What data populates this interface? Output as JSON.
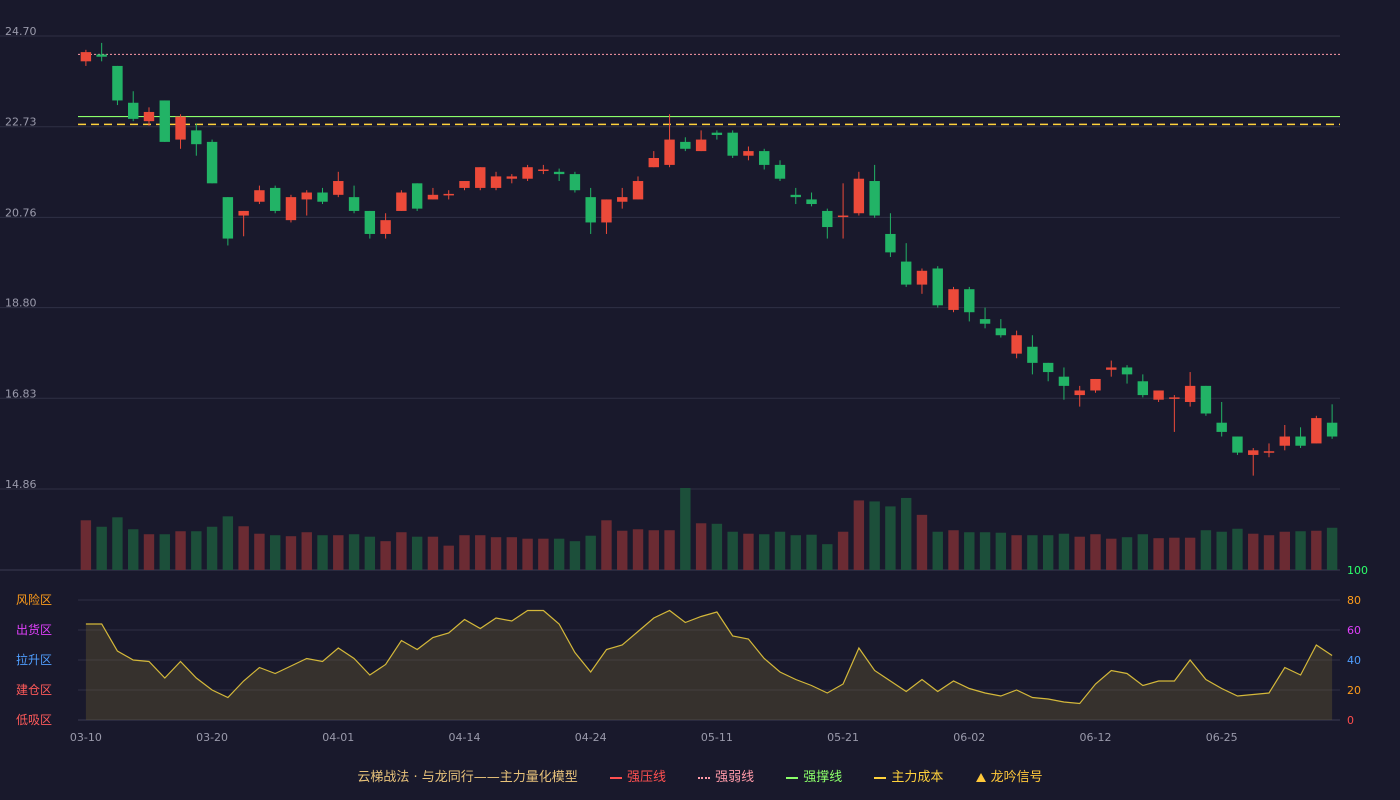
{
  "chart_data": {
    "type": "candlestick",
    "price_axis": {
      "ticks": [
        "24.70",
        "22.73",
        "20.76",
        "18.80",
        "16.83",
        "14.86"
      ],
      "min": 14.86,
      "max": 24.7
    },
    "date_axis": [
      "03-10",
      "03-20",
      "04-01",
      "04-14",
      "04-24",
      "05-11",
      "05-21",
      "06-02",
      "06-12",
      "06-25"
    ],
    "date_tick_index": [
      0,
      8,
      16,
      24,
      32,
      40,
      48,
      56,
      64,
      72
    ],
    "candles": [
      [
        24.15,
        24.35,
        24.4,
        24.05
      ],
      [
        24.3,
        24.25,
        24.55,
        24.15
      ],
      [
        24.05,
        23.3,
        24.05,
        23.2
      ],
      [
        23.25,
        22.9,
        23.5,
        22.85
      ],
      [
        22.85,
        23.05,
        23.15,
        22.75
      ],
      [
        23.3,
        22.4,
        23.3,
        22.4
      ],
      [
        22.45,
        22.95,
        23.0,
        22.25
      ],
      [
        22.65,
        22.35,
        22.8,
        22.1
      ],
      [
        22.4,
        21.5,
        22.45,
        21.5
      ],
      [
        21.2,
        20.3,
        21.2,
        20.15
      ],
      [
        20.8,
        20.9,
        20.9,
        20.35
      ],
      [
        21.1,
        21.35,
        21.45,
        21.05
      ],
      [
        21.4,
        20.9,
        21.45,
        20.85
      ],
      [
        20.7,
        21.2,
        21.25,
        20.65
      ],
      [
        21.15,
        21.3,
        21.35,
        20.8
      ],
      [
        21.3,
        21.1,
        21.4,
        21.05
      ],
      [
        21.25,
        21.55,
        21.75,
        21.2
      ],
      [
        21.2,
        20.9,
        21.45,
        20.85
      ],
      [
        20.9,
        20.4,
        20.9,
        20.3
      ],
      [
        20.4,
        20.7,
        20.85,
        20.3
      ],
      [
        20.9,
        21.3,
        21.35,
        20.9
      ],
      [
        21.5,
        20.95,
        21.5,
        20.9
      ],
      [
        21.15,
        21.25,
        21.4,
        21.15
      ],
      [
        21.25,
        21.27,
        21.35,
        21.15
      ],
      [
        21.4,
        21.55,
        21.55,
        21.35
      ],
      [
        21.4,
        21.85,
        21.85,
        21.35
      ],
      [
        21.4,
        21.65,
        21.75,
        21.35
      ],
      [
        21.6,
        21.65,
        21.7,
        21.5
      ],
      [
        21.6,
        21.85,
        21.9,
        21.55
      ],
      [
        21.8,
        21.8,
        21.9,
        21.7
      ],
      [
        21.75,
        21.7,
        21.82,
        21.55
      ],
      [
        21.7,
        21.35,
        21.75,
        21.3
      ],
      [
        21.2,
        20.65,
        21.4,
        20.4
      ],
      [
        20.65,
        21.15,
        21.15,
        20.4
      ],
      [
        21.1,
        21.2,
        21.4,
        20.95
      ],
      [
        21.15,
        21.55,
        21.65,
        21.15
      ],
      [
        21.85,
        22.05,
        22.2,
        21.85
      ],
      [
        21.9,
        22.45,
        23.0,
        21.85
      ],
      [
        22.4,
        22.25,
        22.5,
        22.2
      ],
      [
        22.2,
        22.45,
        22.65,
        22.2
      ],
      [
        22.6,
        22.55,
        22.65,
        22.45
      ],
      [
        22.6,
        22.1,
        22.65,
        22.05
      ],
      [
        22.1,
        22.2,
        22.3,
        22.0
      ],
      [
        22.2,
        21.9,
        22.25,
        21.8
      ],
      [
        21.9,
        21.6,
        22.0,
        21.55
      ],
      [
        21.25,
        21.2,
        21.4,
        21.05
      ],
      [
        21.15,
        21.05,
        21.3,
        21.0
      ],
      [
        20.9,
        20.55,
        20.95,
        20.3
      ],
      [
        20.8,
        20.8,
        21.5,
        20.3
      ],
      [
        20.85,
        21.6,
        21.75,
        20.8
      ],
      [
        21.55,
        20.8,
        21.9,
        20.75
      ],
      [
        20.4,
        20.0,
        20.85,
        19.9
      ],
      [
        19.8,
        19.3,
        20.2,
        19.25
      ],
      [
        19.3,
        19.6,
        19.65,
        19.1
      ],
      [
        19.65,
        18.85,
        19.7,
        18.8
      ],
      [
        18.75,
        19.2,
        19.25,
        18.7
      ],
      [
        19.2,
        18.7,
        19.25,
        18.5
      ],
      [
        18.55,
        18.45,
        18.8,
        18.35
      ],
      [
        18.35,
        18.2,
        18.55,
        18.15
      ],
      [
        17.8,
        18.2,
        18.3,
        17.7
      ],
      [
        17.95,
        17.6,
        18.2,
        17.35
      ],
      [
        17.6,
        17.4,
        17.6,
        17.2
      ],
      [
        17.3,
        17.1,
        17.5,
        16.8
      ],
      [
        16.9,
        17.0,
        17.1,
        16.65
      ],
      [
        17.0,
        17.25,
        17.25,
        16.95
      ],
      [
        17.45,
        17.5,
        17.65,
        17.3
      ],
      [
        17.5,
        17.35,
        17.55,
        17.15
      ],
      [
        17.2,
        16.9,
        17.35,
        16.85
      ],
      [
        16.8,
        17.0,
        17.0,
        16.75
      ],
      [
        16.85,
        16.85,
        16.9,
        16.1
      ],
      [
        16.75,
        17.1,
        17.4,
        16.65
      ],
      [
        17.1,
        16.5,
        17.1,
        16.45
      ],
      [
        16.3,
        16.1,
        16.75,
        16.0
      ],
      [
        16.0,
        15.65,
        16.0,
        15.6
      ],
      [
        15.6,
        15.7,
        15.75,
        15.15
      ],
      [
        15.65,
        15.68,
        15.85,
        15.55
      ],
      [
        15.8,
        16.0,
        16.25,
        15.7
      ],
      [
        16.0,
        15.8,
        16.2,
        15.75
      ],
      [
        15.85,
        16.4,
        16.45,
        15.85
      ],
      [
        16.3,
        16.0,
        16.7,
        15.95
      ]
    ],
    "volume": [
      100,
      87,
      106,
      82,
      72,
      72,
      78,
      78,
      87,
      108,
      88,
      73,
      70,
      68,
      76,
      70,
      70,
      72,
      67,
      58,
      76,
      67,
      67,
      49,
      70,
      70,
      66,
      66,
      63,
      63,
      63,
      58,
      69,
      100,
      79,
      82,
      80,
      80,
      165,
      94,
      93,
      77,
      73,
      72,
      77,
      70,
      71,
      52,
      77,
      140,
      138,
      128,
      145,
      111,
      77,
      80,
      76,
      76,
      75,
      70,
      70,
      70,
      73,
      67,
      72,
      63,
      66,
      72,
      64,
      65,
      65,
      80,
      77,
      83,
      73,
      70,
      77,
      78,
      79,
      85
    ],
    "risk_indicator": [
      64,
      64,
      46,
      40,
      39,
      28,
      39,
      28,
      20,
      15,
      26,
      35,
      31,
      36,
      41,
      39,
      48,
      41,
      30,
      37,
      53,
      47,
      55,
      58,
      67,
      61,
      68,
      66,
      73,
      73,
      64,
      45,
      32,
      47,
      50,
      59,
      68,
      73,
      65,
      69,
      72,
      56,
      54,
      41,
      32,
      27,
      23,
      18,
      24,
      48,
      33,
      26,
      19,
      27,
      19,
      26,
      21,
      18,
      16,
      20,
      15,
      14,
      12,
      11,
      24,
      33,
      31,
      23,
      26,
      26,
      40,
      27,
      21,
      16,
      17,
      18,
      35,
      30,
      50,
      43
    ],
    "indicator_axis": [
      "100",
      "80",
      "60",
      "40",
      "20",
      "0"
    ],
    "indicator_axis_colors": [
      "#2bff6a",
      "#ff9c1a",
      "#e040fb",
      "#4f9eff",
      "#ff9c1a",
      "#ff4d4d"
    ],
    "zones": [
      {
        "label": "风险区",
        "color": "#ff9c1a"
      },
      {
        "label": "出货区",
        "color": "#e040fb"
      },
      {
        "label": "拉升区",
        "color": "#4f9eff"
      },
      {
        "label": "建仓区",
        "color": "#ff5a5a"
      },
      {
        "label": "低吸区",
        "color": "#ff5a5a"
      }
    ],
    "lines": {
      "strong_support": 22.95,
      "main_cost": 22.78,
      "weak_line": 24.3
    },
    "colors": {
      "up": "#ec4a3a",
      "down": "#22b366",
      "vol_up": "#6b2b33",
      "vol_down": "#1c4f3a",
      "indicator": "#d4b83a",
      "grid": "#2f3045"
    }
  },
  "legend": {
    "title": "云梯战法 · 与龙同行——主力量化模型",
    "title_color": "#e8c27a",
    "items": [
      {
        "label": "强压线",
        "color": "#ff5050",
        "style": "solid"
      },
      {
        "label": "强弱线",
        "color": "#ff9aa8",
        "style": "dotted"
      },
      {
        "label": "强撑线",
        "color": "#8bff6a",
        "style": "solid"
      },
      {
        "label": "主力成本",
        "color": "#ffd23c",
        "style": "dashed"
      },
      {
        "label": "龙吟信号",
        "color": "#ffc83a",
        "style": "triangle"
      }
    ]
  }
}
